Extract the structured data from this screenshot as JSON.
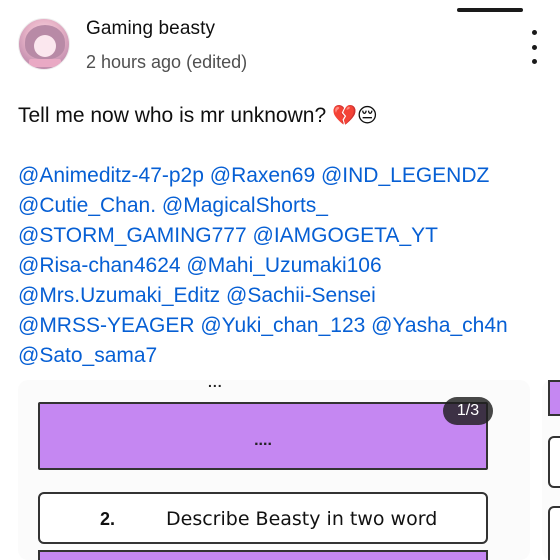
{
  "comment": {
    "author": "Gaming beasty",
    "timestamp": "2 hours ago (edited)",
    "text": "Tell me now who is mr unknown?",
    "emojis": "💔😔",
    "mention_lines": [
      [
        "@Animeditz-47-p2p",
        "@Raxen69",
        "@IND_LEGENDZ"
      ],
      [
        "@Cutie_Chan.",
        "@MagicalShorts_"
      ],
      [
        "@STORM_GAMING777",
        "@IAMGOGETA_YT"
      ],
      [
        "@Risa-chan4624",
        "@Mahi_Uzumaki106"
      ],
      [
        "@Mrs.Uzumaki_Editz",
        "@Sachii-Sensei"
      ],
      [
        "@MRSS-YEAGER",
        "@Yuki_chan_123",
        "@Yasha_ch4n"
      ],
      [
        "@Sato_sama7"
      ]
    ]
  },
  "icons": {
    "more": "more-vert-icon",
    "avatar": "avatar"
  },
  "image_carousel": {
    "counter": "1/3",
    "partial_top_text": "...",
    "answer_placeholder": "....",
    "question_number": "2.",
    "question_text": "Describe Beasty in two word"
  },
  "colors": {
    "mention": "#065fd4",
    "purple": "#c587f2",
    "text": "#0f0f0f",
    "secondary": "#505050"
  }
}
